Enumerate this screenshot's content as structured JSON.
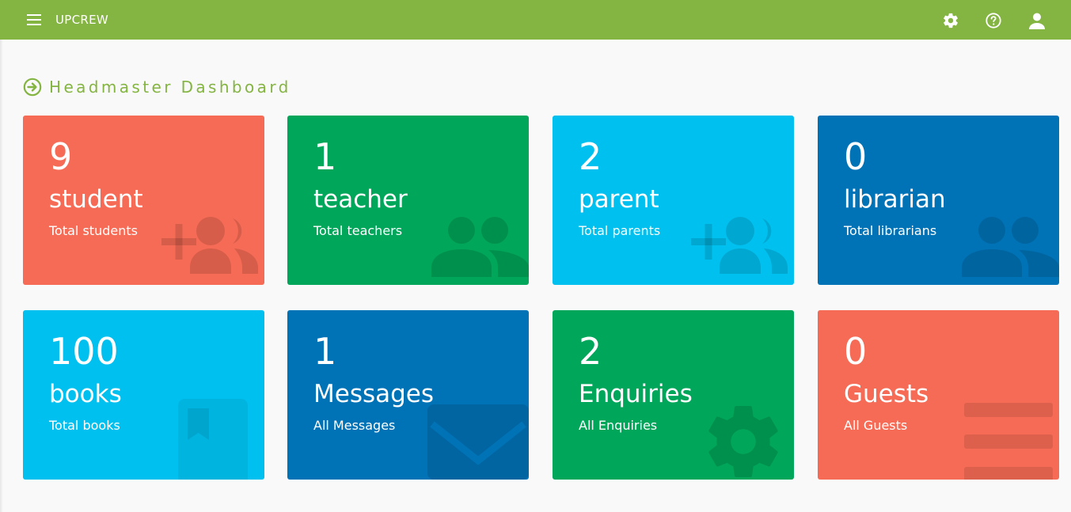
{
  "app": {
    "brand": "UPCREW"
  },
  "header": {
    "menu_icon": "menu-icon",
    "icons": [
      "gear-icon",
      "help-icon",
      "account-icon"
    ]
  },
  "page": {
    "title": "Headmaster Dashboard",
    "title_icon": "arrow-circle-right-icon"
  },
  "colors": {
    "topbar": "#84b441",
    "red": "#f66b55",
    "green": "#00a65a",
    "cyan": "#00c0ef",
    "blue": "#0073b7"
  },
  "cards": [
    {
      "count": "9",
      "name": "student",
      "desc": "Total students",
      "color": "red",
      "icon": "add-users-icon"
    },
    {
      "count": "1",
      "name": "teacher",
      "desc": "Total teachers",
      "color": "green",
      "icon": "users-icon"
    },
    {
      "count": "2",
      "name": "parent",
      "desc": "Total parents",
      "color": "cyan",
      "icon": "add-users-icon"
    },
    {
      "count": "0",
      "name": "librarian",
      "desc": "Total librarians",
      "color": "blue",
      "icon": "users-icon"
    },
    {
      "count": "100",
      "name": "books",
      "desc": "Total books",
      "color": "cyan",
      "icon": "book-icon"
    },
    {
      "count": "1",
      "name": "Messages",
      "desc": "All Messages",
      "color": "blue",
      "icon": "envelope-icon"
    },
    {
      "count": "2",
      "name": "Enquiries",
      "desc": "All Enquiries",
      "color": "green",
      "icon": "gear-icon"
    },
    {
      "count": "0",
      "name": "Guests",
      "desc": "All Guests",
      "color": "red",
      "icon": "list-icon"
    }
  ]
}
